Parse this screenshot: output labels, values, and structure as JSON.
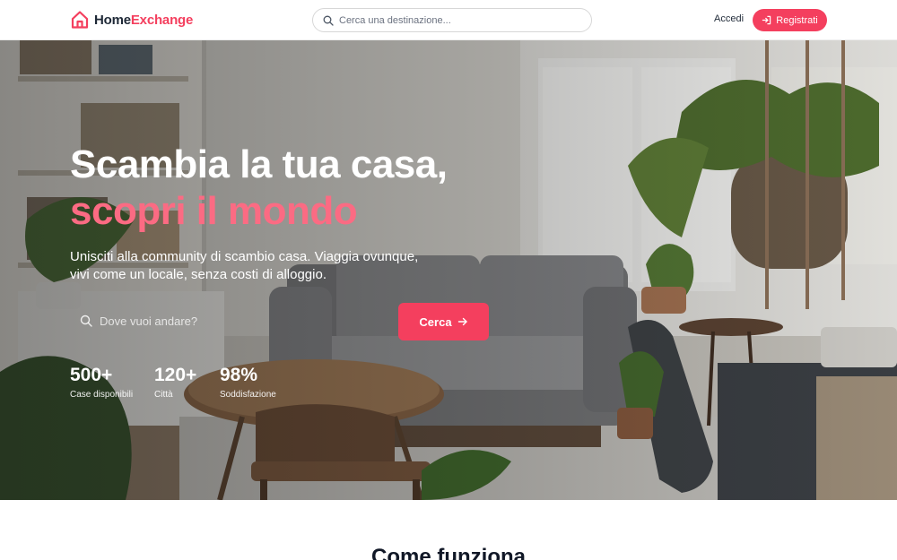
{
  "header": {
    "brand_home": "Home",
    "brand_exchange": "Exchange",
    "search_placeholder": "Cerca una destinazione...",
    "login_label": "Accedi",
    "register_label": "Registrati"
  },
  "hero": {
    "title_line1": "Scambia la tua casa,",
    "title_line2": "scopri il mondo",
    "subtitle": "Unisciti alla community di scambio casa. Viaggia ovunque, vivi come un locale, senza costi di alloggio.",
    "search_placeholder": "Dove vuoi andare?",
    "cta_label": "Cerca",
    "stats": [
      {
        "value": "500+",
        "label": "Case disponibili"
      },
      {
        "value": "120+",
        "label": "Città"
      },
      {
        "value": "98%",
        "label": "Soddisfazione"
      }
    ]
  },
  "section": {
    "title": "Come funziona"
  },
  "colors": {
    "accent": "#f43f5e",
    "accent_light": "#fb6b83",
    "text_dark": "#1f2937"
  },
  "icons": {
    "brand": "house-icon",
    "search": "search-icon",
    "register": "login-arrow-icon",
    "cta": "arrow-right-icon"
  }
}
